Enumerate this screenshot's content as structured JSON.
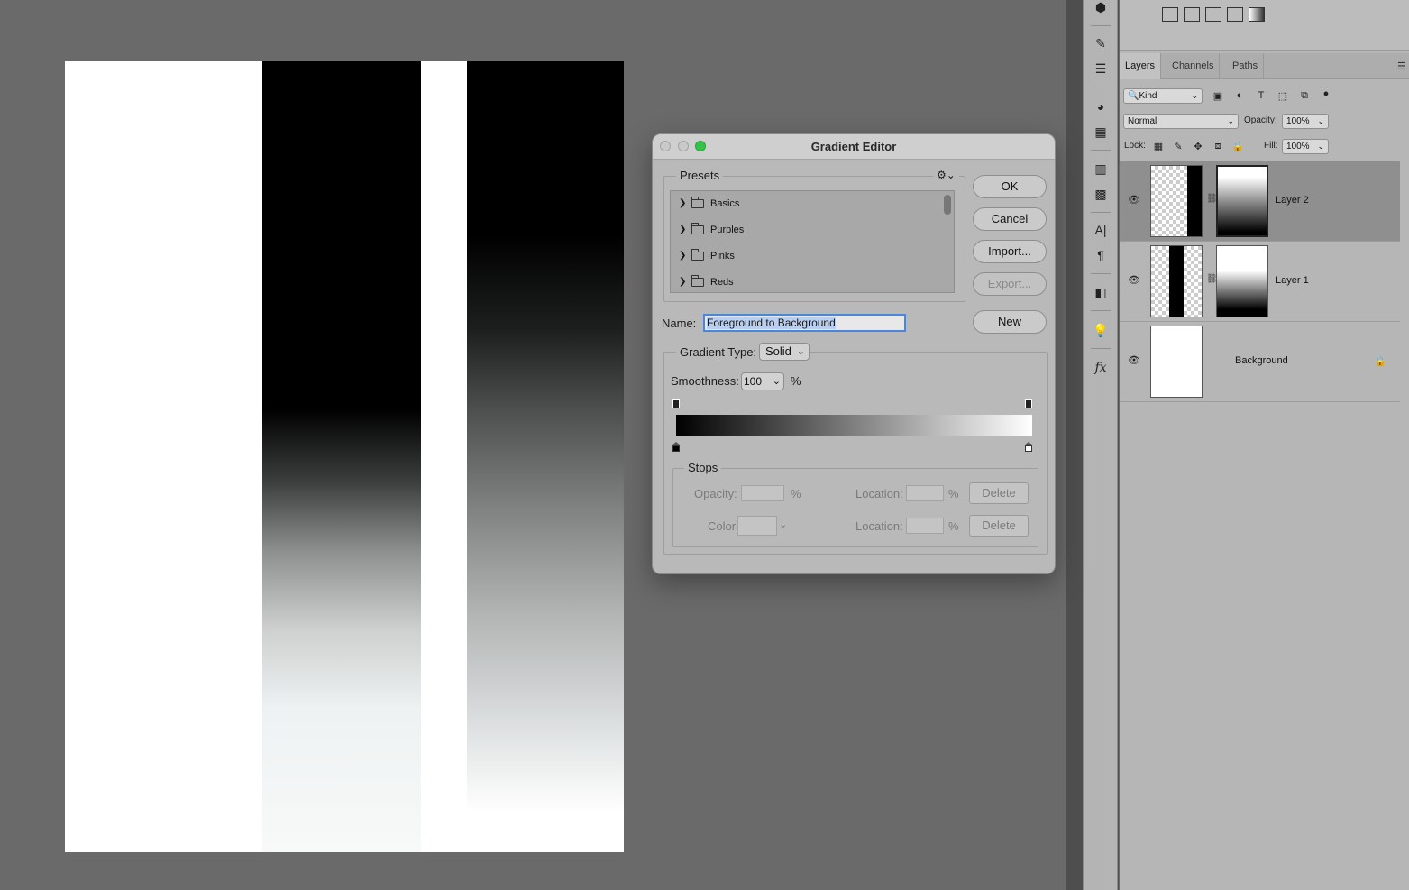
{
  "dialog": {
    "title": "Gradient Editor",
    "presets_label": "Presets",
    "presets": [
      "Basics",
      "Purples",
      "Pinks",
      "Reds"
    ],
    "buttons": {
      "ok": "OK",
      "cancel": "Cancel",
      "import": "Import...",
      "export": "Export...",
      "new": "New"
    },
    "name_label": "Name:",
    "name_value": "Foreground to Background",
    "gradient_type_label": "Gradient Type:",
    "gradient_type_value": "Solid",
    "smoothness_label": "Smoothness:",
    "smoothness_value": "100",
    "percent": "%",
    "stops": {
      "label": "Stops",
      "opacity_label": "Opacity:",
      "color_label": "Color:",
      "location_label": "Location:",
      "delete_label": "Delete"
    }
  },
  "layers_panel": {
    "tabs": [
      "Layers",
      "Channels",
      "Paths"
    ],
    "filter_label": "Kind",
    "blend_mode": "Normal",
    "opacity_label": "Opacity:",
    "opacity_value": "100%",
    "lock_label": "Lock:",
    "fill_label": "Fill:",
    "fill_value": "100%",
    "layers": [
      {
        "name": "Layer 2",
        "selected": true
      },
      {
        "name": "Layer 1",
        "selected": false
      },
      {
        "name": "Background",
        "selected": false,
        "locked": true
      }
    ]
  },
  "tool_strip_icons": [
    "cube-icon",
    "brush-settings-icon",
    "properties-icon",
    "color-icon",
    "swatches-icon",
    "gradients-icon",
    "patterns-icon",
    "character-icon",
    "paragraph-icon",
    "libraries-icon",
    "learn-icon",
    "styles-icon"
  ],
  "colors": {
    "accent": "#4b86d8",
    "traffic_green": "#35c24a"
  }
}
